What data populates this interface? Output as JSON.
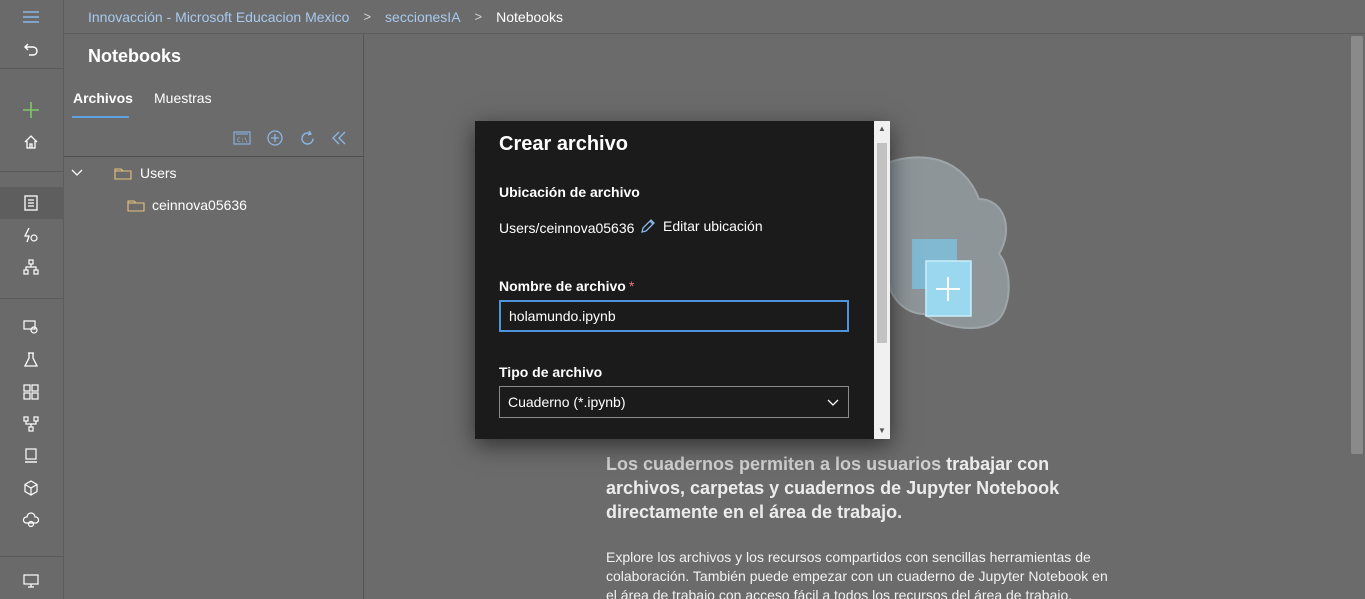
{
  "breadcrumb": {
    "workspace": "Innovacción - Microsoft Educacion Mexico",
    "section": "seccionesIA",
    "current": "Notebooks"
  },
  "panel": {
    "title": "Notebooks",
    "tabs": [
      "Archivos",
      "Muestras"
    ],
    "tree": {
      "root": "Users",
      "child": "ceinnova05636"
    }
  },
  "dialog": {
    "title": "Crear archivo",
    "location_label": "Ubicación de archivo",
    "location_value": "Users/ceinnova05636",
    "edit_location": "Editar ubicación",
    "name_label": "Nombre de archivo",
    "required_mark": "*",
    "name_value": "holamundo.ipynb",
    "type_label": "Tipo de archivo",
    "type_value": "Cuaderno (*.ipynb)"
  },
  "info": {
    "headline_dim": "Los cuadernos permiten a los usuarios",
    "headline_bold": " trabajar con archivos, carpetas y cuadernos de Jupyter Notebook directamente en el área de trabajo.",
    "body": "Explore los archivos y los recursos compartidos con sencillas herramientas de colaboración. También puede empezar con un cuaderno de Jupyter Notebook en el área de trabajo con acceso fácil a todos los recursos del área de trabajo."
  },
  "colors": {
    "accent": "#5fa0e0",
    "input_border": "#4f94db",
    "link": "#a9c9ef",
    "required": "#e8767d"
  }
}
